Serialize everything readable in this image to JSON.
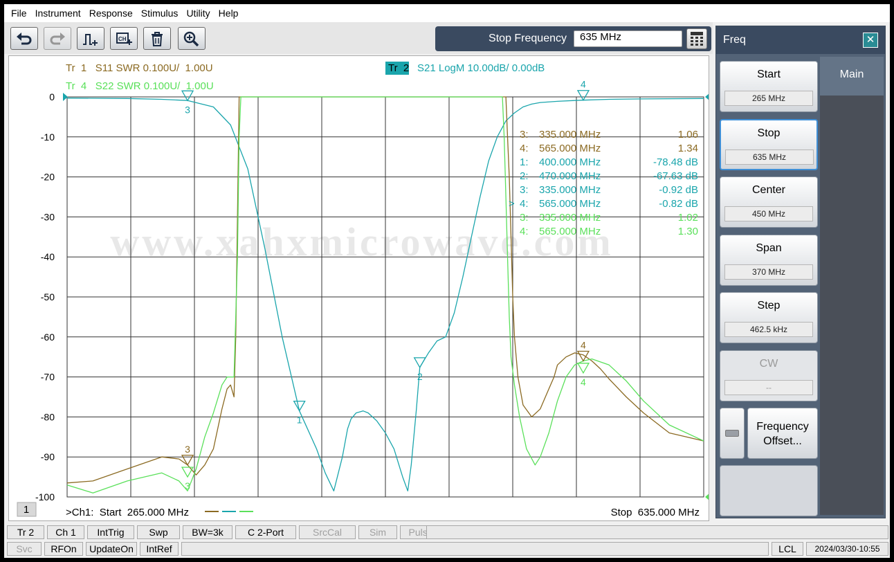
{
  "menu": [
    "File",
    "Instrument",
    "Response",
    "Stimulus",
    "Utility",
    "Help"
  ],
  "toolbar": {
    "buttons": [
      "undo-icon",
      "redo-icon",
      "add-marker-icon",
      "channel-add-icon",
      "trash-icon",
      "zoom-icon"
    ],
    "entry_label": "Stop Frequency",
    "entry_value": "635 MHz"
  },
  "side_panel": {
    "title": "Freq",
    "tab": "Main",
    "buttons": [
      {
        "label": "Start",
        "value": "265 MHz",
        "state": "normal"
      },
      {
        "label": "Stop",
        "value": "635 MHz",
        "state": "active"
      },
      {
        "label": "Center",
        "value": "450 MHz",
        "state": "normal"
      },
      {
        "label": "Span",
        "value": "370 MHz",
        "state": "normal"
      },
      {
        "label": "Step",
        "value": "462.5 kHz",
        "state": "normal"
      },
      {
        "label": "CW",
        "value": "--",
        "state": "disabled"
      }
    ],
    "freq_offset_line1": "Frequency",
    "freq_offset_line2": "Offset..."
  },
  "chart_data": {
    "type": "line",
    "trace_headers": [
      {
        "text": "Tr  1   S11 SWR 0.100U/  1.00U",
        "color": "#8b6a22"
      },
      {
        "text": "Tr  4   S22 SWR 0.100U/  1.00U",
        "color": "#5ae05a"
      }
    ],
    "active_trace": {
      "tag": "Tr  2",
      "text": "S21 LogM 10.00dB/  0.00dB",
      "color": "#1aa5ac"
    },
    "y_ticks": [
      "0",
      "-10",
      "-20",
      "-30",
      "-40",
      "-50",
      "-60",
      "-70",
      "-80",
      "-90",
      "-100"
    ],
    "ylim": [
      -100,
      0
    ],
    "xlim": [
      265,
      635
    ],
    "grid": true,
    "watermark": "www.xahxmicrowave.com",
    "footer_left": ">Ch1:  Start  265.000 MHz",
    "footer_right": "Stop  635.000 MHz",
    "channel_number": "1",
    "marker_table": [
      {
        "prefix": "",
        "id": "3:",
        "freq": "335.000  MHz",
        "value": "1.06",
        "color": "#8b6a22"
      },
      {
        "prefix": "",
        "id": "4:",
        "freq": "565.000  MHz",
        "value": "1.34",
        "color": "#8b6a22"
      },
      {
        "prefix": "",
        "id": "1:",
        "freq": "400.000  MHz",
        "value": "-78.48 dB",
        "color": "#1aa5ac"
      },
      {
        "prefix": "",
        "id": "2:",
        "freq": "470.000  MHz",
        "value": "-67.63 dB",
        "color": "#1aa5ac"
      },
      {
        "prefix": "",
        "id": "3:",
        "freq": "335.000  MHz",
        "value": "-0.92 dB",
        "color": "#1aa5ac"
      },
      {
        "prefix": ">",
        "id": "4:",
        "freq": "565.000  MHz",
        "value": "-0.82 dB",
        "color": "#1aa5ac"
      },
      {
        "prefix": "",
        "id": "3:",
        "freq": "335.000  MHz",
        "value": "1.02",
        "color": "#5ae05a"
      },
      {
        "prefix": "",
        "id": "4:",
        "freq": "565.000  MHz",
        "value": "1.30",
        "color": "#5ae05a"
      }
    ],
    "markers": [
      {
        "label": "3",
        "trace": "S21",
        "x": 335,
        "y": -0.92,
        "color": "#1aa5ac"
      },
      {
        "label": "4",
        "trace": "S21",
        "x": 565,
        "y": -0.82,
        "color": "#1aa5ac"
      },
      {
        "label": "1",
        "trace": "S21",
        "x": 400,
        "y": -78.48,
        "color": "#1aa5ac"
      },
      {
        "label": "2",
        "trace": "S21",
        "x": 470,
        "y": -67.63,
        "color": "#1aa5ac"
      },
      {
        "label": "3",
        "trace": "S11",
        "x": 335,
        "y": -92,
        "color": "#8b6a22"
      },
      {
        "label": "4",
        "trace": "S11",
        "x": 565,
        "y": -66,
        "color": "#8b6a22"
      },
      {
        "label": "3",
        "trace": "S22",
        "x": 335,
        "y": -95,
        "color": "#5ae05a"
      },
      {
        "label": "4",
        "trace": "S22",
        "x": 565,
        "y": -69,
        "color": "#5ae05a"
      }
    ],
    "series": [
      {
        "name": "S21",
        "color": "#1aa5ac",
        "x": [
          265,
          300,
          320,
          335,
          350,
          360,
          370,
          380,
          390,
          400,
          410,
          415,
          420,
          425,
          428,
          430,
          433,
          437,
          440,
          445,
          450,
          455,
          460,
          463,
          465,
          468,
          470,
          475,
          480,
          485,
          490,
          495,
          500,
          505,
          510,
          515,
          520,
          525,
          530,
          535,
          540,
          550,
          560,
          565,
          580,
          600,
          635
        ],
        "y": [
          -0.3,
          -0.4,
          -0.6,
          -0.9,
          -2.5,
          -7,
          -18,
          -38,
          -60,
          -78.5,
          -88,
          -94,
          -98.5,
          -90,
          -83,
          -80.5,
          -79,
          -78.5,
          -79,
          -81,
          -84,
          -88,
          -95,
          -98.5,
          -92,
          -78,
          -67.6,
          -64,
          -61,
          -60,
          -54,
          -45,
          -35,
          -25,
          -16,
          -10,
          -6,
          -4,
          -2.5,
          -1.8,
          -1.4,
          -1.1,
          -0.9,
          -0.82,
          -0.6,
          -0.5,
          -0.4
        ]
      },
      {
        "name": "S11",
        "color": "#8b6a22",
        "x": [
          265,
          280,
          300,
          320,
          330,
          335,
          340,
          345,
          350,
          355,
          358,
          360,
          362,
          363,
          364,
          365,
          520,
          521,
          522,
          523,
          524,
          525,
          527,
          530,
          535,
          540,
          545,
          548,
          550,
          555,
          560,
          565,
          570,
          575,
          580,
          590,
          600,
          615,
          635
        ],
        "y": [
          -96.5,
          -96,
          -93,
          -90,
          -90.5,
          -92,
          -94.5,
          -92,
          -88,
          -78,
          -73,
          -72,
          -75,
          -60,
          -30,
          0,
          0,
          -10,
          -20,
          -35,
          -50,
          -60,
          -70,
          -77,
          -80,
          -78,
          -73,
          -70,
          -67,
          -65,
          -64,
          -64.5,
          -66,
          -68,
          -70.5,
          -75,
          -79,
          -84,
          -86
        ]
      },
      {
        "name": "S22",
        "color": "#5ae05a",
        "x": [
          265,
          280,
          300,
          320,
          330,
          335,
          340,
          345,
          350,
          355,
          358,
          362,
          364,
          365,
          366,
          518,
          519,
          520,
          521,
          522,
          523,
          525,
          528,
          532,
          537,
          540,
          545,
          550,
          555,
          560,
          565,
          570,
          580,
          590,
          600,
          615,
          635
        ],
        "y": [
          -97,
          -99,
          -96,
          -94,
          -96,
          -98.5,
          -93,
          -85,
          -79,
          -72,
          -70,
          -70,
          -40,
          -10,
          0,
          0,
          -10,
          -25,
          -40,
          -55,
          -65,
          -72,
          -80,
          -88,
          -92,
          -90,
          -84,
          -76,
          -70,
          -67,
          -66,
          -65.5,
          -67,
          -71,
          -76,
          -82,
          -86
        ]
      }
    ]
  },
  "status_row1": [
    {
      "label": "Tr 2",
      "state": "normal"
    },
    {
      "label": "Ch 1",
      "state": "normal"
    },
    {
      "label": "IntTrig",
      "state": "normal"
    },
    {
      "label": "Swp",
      "state": "normal"
    },
    {
      "label": "BW=3k",
      "state": "normal"
    },
    {
      "label": "C  2-Port",
      "state": "normal"
    },
    {
      "label": "SrcCal",
      "state": "disabled"
    },
    {
      "label": "Sim",
      "state": "disabled"
    },
    {
      "label": "Pulse",
      "state": "disabled"
    }
  ],
  "status_row2": [
    {
      "label": "Svc",
      "state": "disabled"
    },
    {
      "label": "RFOn",
      "state": "normal"
    },
    {
      "label": "UpdateOn",
      "state": "normal"
    },
    {
      "label": "IntRef",
      "state": "normal"
    }
  ],
  "status_right": {
    "lcl": "LCL",
    "datetime": "2024/03/30-10:55"
  }
}
